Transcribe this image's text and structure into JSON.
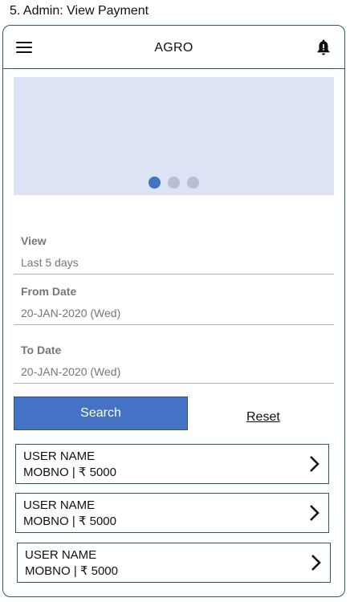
{
  "caption": "5. Admin: View Payment",
  "appbar": {
    "title": "AGRO",
    "menu_icon": "hamburger-menu-icon",
    "notification_icon": "bell-icon"
  },
  "carousel": {
    "slide_count": 3,
    "active_index": 0
  },
  "filters": {
    "view": {
      "label": "View",
      "value": "Last 5 days"
    },
    "from_date": {
      "label": "From Date",
      "value": "20-JAN-2020 (Wed)"
    },
    "to_date": {
      "label": "To Date",
      "value": "20-JAN-2020 (Wed)"
    }
  },
  "actions": {
    "search_label": "Search",
    "reset_label": "Reset"
  },
  "payments": [
    {
      "user_name": "USER NAME",
      "details": "MOBNO  | ₹ 5000"
    },
    {
      "user_name": "USER NAME",
      "details": "MOBNO  | ₹ 5000"
    },
    {
      "user_name": "USER NAME",
      "details": "MOBNO  | ₹ 5000"
    }
  ],
  "colors": {
    "accent": "#4472c4",
    "border": "#2f5575",
    "carousel_bg": "#dce3f4",
    "inactive_dot": "#b7c0d3"
  }
}
